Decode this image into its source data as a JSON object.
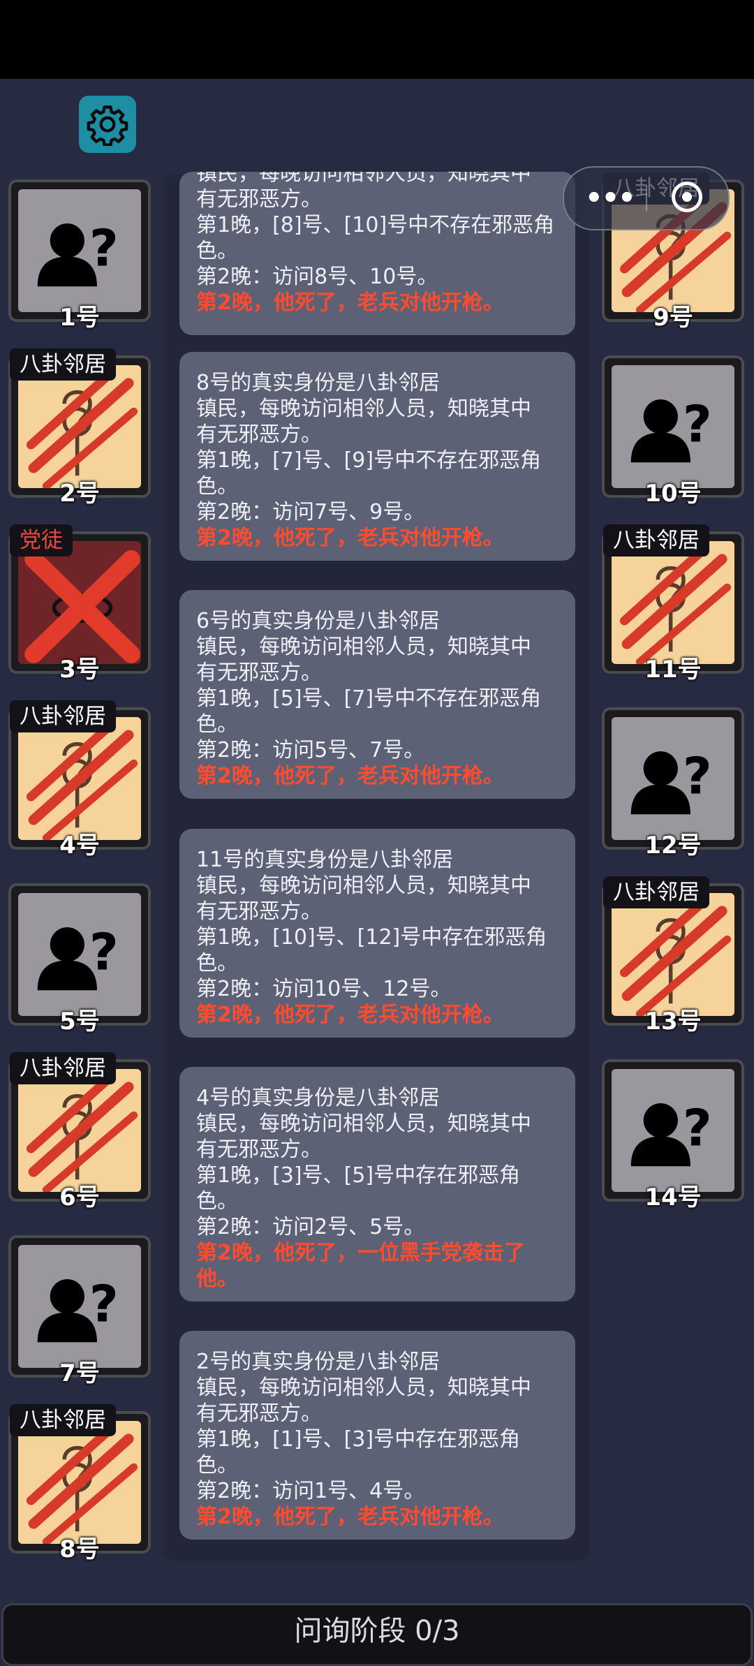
{
  "players": [
    {
      "num": "1号",
      "tag": "",
      "state": "unknown"
    },
    {
      "num": "2号",
      "tag": "八卦邻居",
      "state": "dead-neighbor"
    },
    {
      "num": "3号",
      "tag": "党徒",
      "state": "dead-villain"
    },
    {
      "num": "4号",
      "tag": "八卦邻居",
      "state": "dead-neighbor"
    },
    {
      "num": "5号",
      "tag": "",
      "state": "unknown"
    },
    {
      "num": "6号",
      "tag": "八卦邻居",
      "state": "dead-neighbor"
    },
    {
      "num": "7号",
      "tag": "",
      "state": "unknown"
    },
    {
      "num": "8号",
      "tag": "八卦邻居",
      "state": "dead-neighbor"
    },
    {
      "num": "9号",
      "tag": "八卦邻居",
      "state": "dead-neighbor"
    },
    {
      "num": "10号",
      "tag": "",
      "state": "unknown"
    },
    {
      "num": "11号",
      "tag": "八卦邻居",
      "state": "dead-neighbor"
    },
    {
      "num": "12号",
      "tag": "",
      "state": "unknown"
    },
    {
      "num": "13号",
      "tag": "八卦邻居",
      "state": "dead-neighbor"
    },
    {
      "num": "14号",
      "tag": "",
      "state": "unknown"
    }
  ],
  "log": [
    {
      "lines": [
        "镇民，每晚访问相邻人员，知晓其中",
        "有无邪恶方。",
        "第1晚，[8]号、[10]号中不存在邪恶角",
        "色。",
        "第2晚：访问8号、10号。"
      ],
      "result": "第2晚，他死了，老兵对他开枪。"
    },
    {
      "lines": [
        "8号的真实身份是八卦邻居",
        "镇民，每晚访问相邻人员，知晓其中",
        "有无邪恶方。",
        "第1晚，[7]号、[9]号中不存在邪恶角",
        "色。",
        "第2晚：访问7号、9号。"
      ],
      "result": "第2晚，他死了，老兵对他开枪。"
    },
    {
      "lines": [
        "6号的真实身份是八卦邻居",
        "镇民，每晚访问相邻人员，知晓其中",
        "有无邪恶方。",
        "第1晚，[5]号、[7]号中不存在邪恶角",
        "色。",
        "第2晚：访问5号、7号。"
      ],
      "result": "第2晚，他死了，老兵对他开枪。"
    },
    {
      "lines": [
        "11号的真实身份是八卦邻居",
        "镇民，每晚访问相邻人员，知晓其中",
        "有无邪恶方。",
        "第1晚，[10]号、[12]号中存在邪恶角",
        "色。",
        "第2晚：访问10号、12号。"
      ],
      "result": "第2晚，他死了，老兵对他开枪。"
    },
    {
      "lines": [
        "4号的真实身份是八卦邻居",
        "镇民，每晚访问相邻人员，知晓其中",
        "有无邪恶方。",
        "第1晚，[3]号、[5]号中存在邪恶角",
        "色。",
        "第2晚：访问2号、5号。"
      ],
      "result": "第2晚，他死了，一位黑手党袭击了他。"
    },
    {
      "lines": [
        "2号的真实身份是八卦邻居",
        "镇民，每晚访问相邻人员，知晓其中",
        "有无邪恶方。",
        "第1晚，[1]号、[3]号中存在邪恶角",
        "色。",
        "第2晚：访问1号、4号。"
      ],
      "result": "第2晚，他死了，老兵对他开枪。"
    }
  ],
  "phase_label": "问询阶段 0/3",
  "colors": {
    "accent": "#1d8ea3",
    "result": "#ff4b2e",
    "bg": "#272b42"
  }
}
